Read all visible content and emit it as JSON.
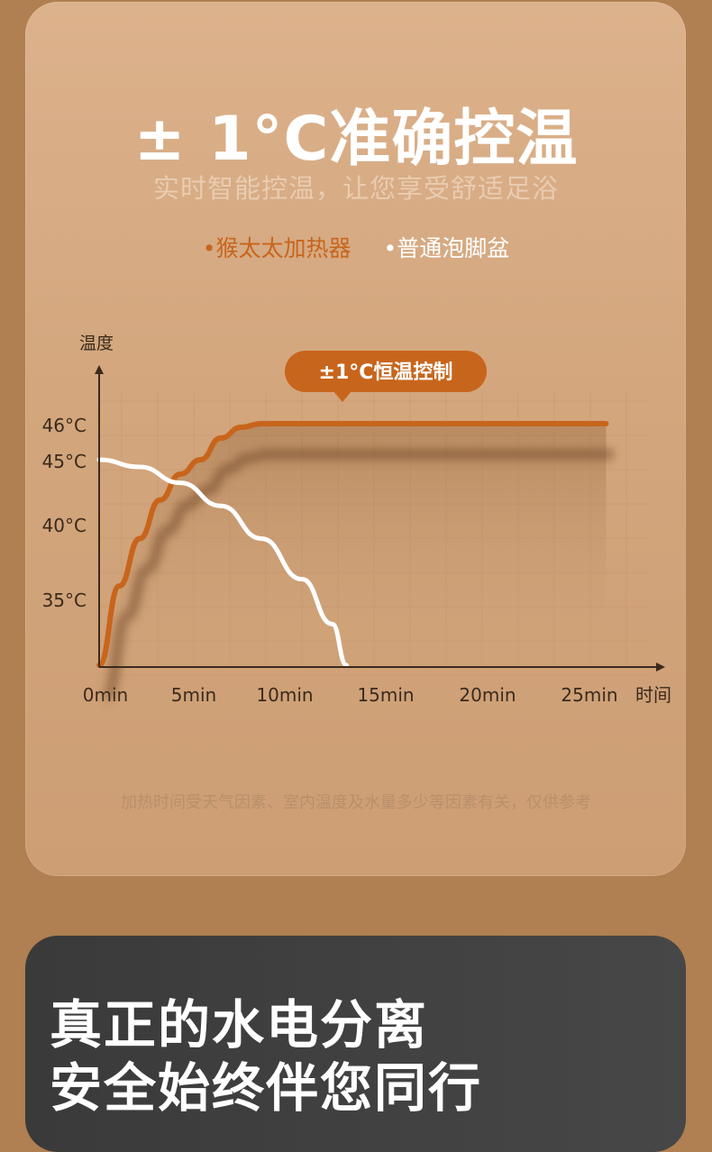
{
  "header": {
    "title": "± 1°C准确控温",
    "subtitle": "实时智能控温，让您享受舒适足浴"
  },
  "legend": {
    "series_a": "•猴太太加热器",
    "series_b": "•普通泡脚盆"
  },
  "chart_data": {
    "type": "line",
    "ylabel": "温度",
    "xlabel": "时间",
    "x_ticks": [
      "0min",
      "5min",
      "10min",
      "15min",
      "20min",
      "25min"
    ],
    "y_ticks": [
      "46°C",
      "45°C",
      "40°C",
      "35°C"
    ],
    "callout": "±1°C恒温控制",
    "series": [
      {
        "name": "猴太太加热器",
        "color": "#c8651c",
        "points": [
          [
            0,
            31
          ],
          [
            1,
            36
          ],
          [
            2,
            39.5
          ],
          [
            3,
            42.2
          ],
          [
            4,
            44
          ],
          [
            5,
            45
          ],
          [
            6,
            45.6
          ],
          [
            7,
            45.9
          ],
          [
            8,
            46
          ],
          [
            10,
            46
          ],
          [
            15,
            46
          ],
          [
            20,
            46
          ],
          [
            25,
            46
          ]
        ]
      },
      {
        "name": "普通泡脚盆",
        "color": "#ffffff",
        "points": [
          [
            0,
            45
          ],
          [
            2,
            44.5
          ],
          [
            4,
            43.4
          ],
          [
            6,
            41.8
          ],
          [
            8,
            39.5
          ],
          [
            10,
            36.5
          ],
          [
            11.5,
            33.5
          ],
          [
            12.2,
            31
          ]
        ]
      }
    ]
  },
  "footnote": "加热时间受天气因素、室内温度及水量多少等因素有关，仅供参考",
  "bottom": {
    "line1": "真正的水电分离",
    "line2": "安全始终伴您同行"
  }
}
